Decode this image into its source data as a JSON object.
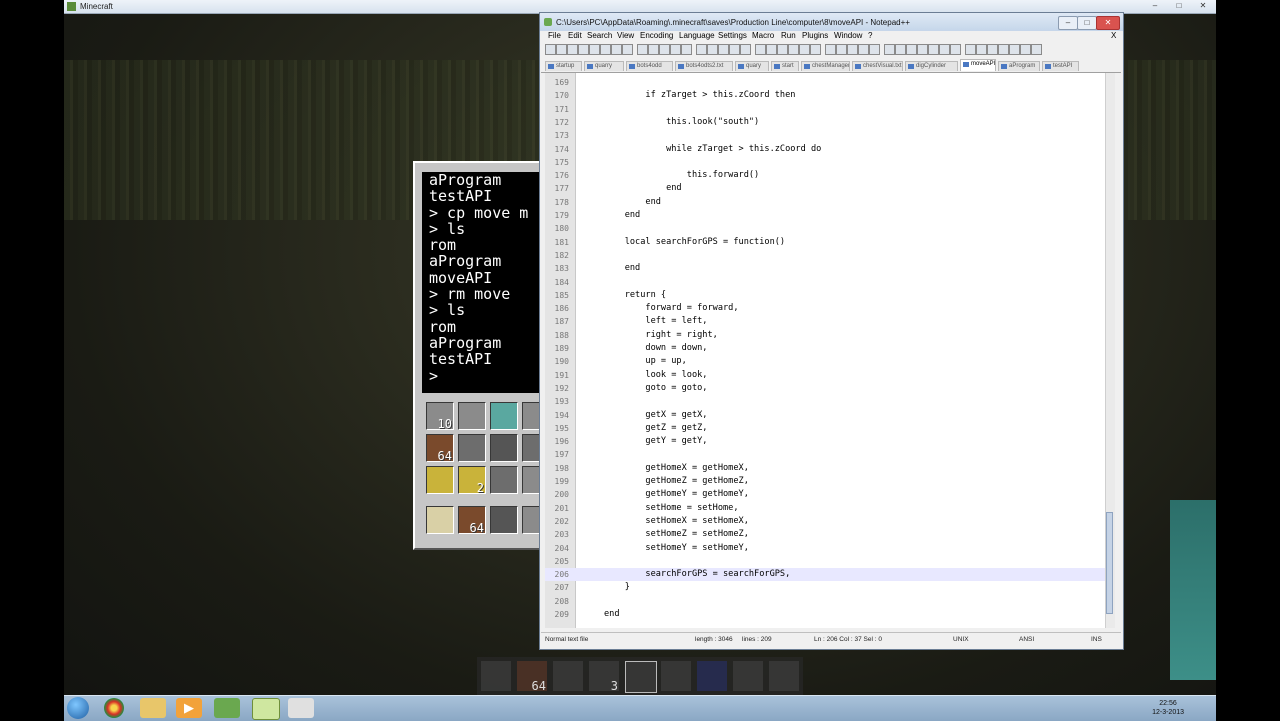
{
  "mc": {
    "title": "Minecraft",
    "terminal_lines": [
      "aProgram",
      "testAPI",
      "> cp move m",
      "> ls",
      "rom",
      "aProgram",
      "moveAPI",
      "> rm move",
      "> ls",
      "rom",
      "aProgram",
      "testAPI",
      ">"
    ],
    "inventory_counts": [
      "10",
      "64",
      "2",
      "64"
    ],
    "hotbar_counts": [
      "64",
      "3"
    ]
  },
  "npp": {
    "title": "C:\\Users\\PC\\AppData\\Roaming\\.minecraft\\saves\\Production Line\\computer\\8\\moveAPI - Notepad++",
    "min_label": "–",
    "max_label": "□",
    "close_label": "✕",
    "menu": [
      "File",
      "Edit",
      "Search",
      "View",
      "Encoding",
      "Language",
      "Settings",
      "Macro",
      "Run",
      "Plugins",
      "Window",
      "?"
    ],
    "menu_close": "X",
    "tabs": [
      "startup",
      "quarry",
      "bots4odd",
      "bots4odts2.txt",
      "quary",
      "start",
      "chestManager",
      "chestVisual.txt",
      "digCylinder",
      "moveAPI",
      "aProgram",
      "testAPI"
    ],
    "active_tab": "moveAPI",
    "code": [
      {
        "n": "169",
        "t": ""
      },
      {
        "n": "170",
        "t": "        if zTarget > this.zCoord then"
      },
      {
        "n": "171",
        "t": ""
      },
      {
        "n": "172",
        "t": "            this.look(\"south\")"
      },
      {
        "n": "173",
        "t": ""
      },
      {
        "n": "174",
        "t": "            while zTarget > this.zCoord do"
      },
      {
        "n": "175",
        "t": ""
      },
      {
        "n": "176",
        "t": "                this.forward()"
      },
      {
        "n": "177",
        "t": "            end"
      },
      {
        "n": "178",
        "t": "        end"
      },
      {
        "n": "179",
        "t": "    end"
      },
      {
        "n": "180",
        "t": ""
      },
      {
        "n": "181",
        "t": "    local searchForGPS = function()"
      },
      {
        "n": "182",
        "t": ""
      },
      {
        "n": "183",
        "t": "    end"
      },
      {
        "n": "184",
        "t": ""
      },
      {
        "n": "185",
        "t": "    return {"
      },
      {
        "n": "186",
        "t": "        forward = forward,"
      },
      {
        "n": "187",
        "t": "        left = left,"
      },
      {
        "n": "188",
        "t": "        right = right,"
      },
      {
        "n": "189",
        "t": "        down = down,"
      },
      {
        "n": "190",
        "t": "        up = up,"
      },
      {
        "n": "191",
        "t": "        look = look,"
      },
      {
        "n": "192",
        "t": "        goto = goto,"
      },
      {
        "n": "193",
        "t": ""
      },
      {
        "n": "194",
        "t": "        getX = getX,"
      },
      {
        "n": "195",
        "t": "        getZ = getZ,"
      },
      {
        "n": "196",
        "t": "        getY = getY,"
      },
      {
        "n": "197",
        "t": ""
      },
      {
        "n": "198",
        "t": "        getHomeX = getHomeX,"
      },
      {
        "n": "199",
        "t": "        getHomeZ = getHomeZ,"
      },
      {
        "n": "200",
        "t": "        getHomeY = getHomeY,"
      },
      {
        "n": "201",
        "t": "        setHome = setHome,"
      },
      {
        "n": "202",
        "t": "        setHomeX = setHomeX,"
      },
      {
        "n": "203",
        "t": "        setHomeZ = setHomeZ,"
      },
      {
        "n": "204",
        "t": "        setHomeY = setHomeY,"
      },
      {
        "n": "205",
        "t": ""
      },
      {
        "n": "206",
        "t": "        searchForGPS = searchForGPS,"
      },
      {
        "n": "207",
        "t": "    }"
      },
      {
        "n": "208",
        "t": ""
      },
      {
        "n": "209",
        "t": "end"
      }
    ],
    "current_line": "206",
    "status": {
      "type": "Normal text file",
      "length": "length : 3046",
      "lines": "lines : 209",
      "pos": "Ln : 206   Col : 37   Sel : 0",
      "eol": "UNIX",
      "enc": "ANSI",
      "mode": "INS"
    }
  },
  "taskbar": {
    "time": "22:56",
    "date": "12-3-2013"
  }
}
